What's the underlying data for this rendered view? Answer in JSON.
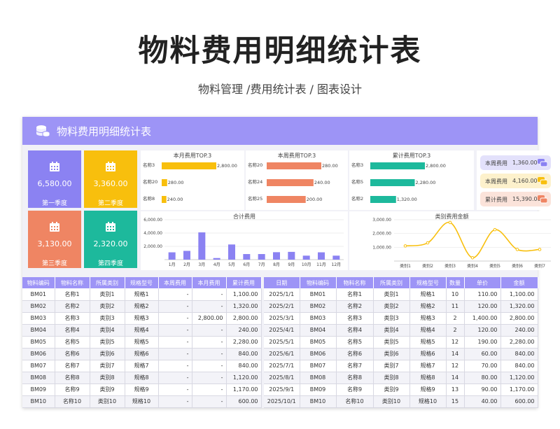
{
  "page": {
    "title": "物料费用明细统计表",
    "subtitle": "物料管理 /费用统计表 / 图表设计"
  },
  "sheet": {
    "header_title": "物料费用明细统计表",
    "header_icon": "coins-icon",
    "color_accent": "#9d94f6"
  },
  "kpi_tiles": [
    {
      "value": "6,580.00",
      "label": "第一季度",
      "color": "#8b82f2",
      "icon": "calendar-icon"
    },
    {
      "value": "3,360.00",
      "label": "第二季度",
      "color": "#f8bf0d",
      "icon": "calendar-icon"
    },
    {
      "value": "3,130.00",
      "label": "第三季度",
      "color": "#ef8563",
      "icon": "calendar-icon"
    },
    {
      "value": "2,320.00",
      "label": "第四季度",
      "color": "#1db99c",
      "icon": "calendar-icon"
    }
  ],
  "summary": [
    {
      "label": "本周费用",
      "value": "1,360.00",
      "bg": "#e3e1fb",
      "icon_color": "#8b82f2",
      "icon": "coins-icon"
    },
    {
      "label": "本周费用",
      "value": "4,160.00",
      "bg": "#fdf1cc",
      "icon_color": "#f8bf0d",
      "icon": "coins-icon"
    },
    {
      "label": "累计费用",
      "value": "15,390.00",
      "bg": "#fbe3da",
      "icon_color": "#ef8563",
      "icon": "coins-icon"
    }
  ],
  "chart_data": [
    {
      "type": "bar",
      "orientation": "horizontal",
      "title": "本月费用TOP.3",
      "color": "#f8bf0d",
      "categories": [
        "名称3",
        "名称20",
        "名称8"
      ],
      "values": [
        2800,
        280,
        240
      ],
      "value_labels": [
        "2,800.00",
        "280.00",
        "240.00"
      ],
      "xlim": [
        0,
        2800
      ]
    },
    {
      "type": "bar",
      "orientation": "horizontal",
      "title": "本周费用TOP.3",
      "color": "#ef8563",
      "categories": [
        "名称20",
        "名称24",
        "名称25"
      ],
      "values": [
        280,
        240,
        200
      ],
      "value_labels": [
        "280.00",
        "240.00",
        "200.00"
      ],
      "xlim": [
        0,
        280
      ]
    },
    {
      "type": "bar",
      "orientation": "horizontal",
      "title": "累计费用TOP.3",
      "color": "#1db99c",
      "categories": [
        "名称3",
        "名称5",
        "名称2"
      ],
      "values": [
        2800,
        2280,
        1320
      ],
      "value_labels": [
        "2,800.00",
        "2,280.00",
        "1,320.00"
      ],
      "xlim": [
        0,
        2800
      ]
    },
    {
      "type": "bar",
      "title": "合计费用",
      "color": "#8b82f2",
      "categories": [
        "1月",
        "2月",
        "3月",
        "4月",
        "5月",
        "6月",
        "7月",
        "8月",
        "9月",
        "10月",
        "11月",
        "12月"
      ],
      "values": [
        1100,
        1320,
        4100,
        240,
        2280,
        840,
        840,
        1120,
        1170,
        600,
        1100,
        600
      ],
      "yticks": [
        {
          "value": 0,
          "label": ""
        },
        {
          "value": 2000,
          "label": "2,000.00"
        },
        {
          "value": 4000,
          "label": "4,000.00"
        },
        {
          "value": 6000,
          "label": "6,000.00"
        }
      ],
      "ylim": [
        0,
        6000
      ],
      "grid": true
    },
    {
      "type": "line",
      "smooth": true,
      "title": "类别费用金额",
      "color": "#f8bf0d",
      "categories": [
        "类别1",
        "类别2",
        "类别3",
        "类别4",
        "类别5",
        "类别6",
        "类别7"
      ],
      "values": [
        1100,
        1320,
        2800,
        240,
        2280,
        840,
        840
      ],
      "yticks": [
        {
          "value": 0,
          "label": ""
        },
        {
          "value": 1000,
          "label": "1,000.00"
        },
        {
          "value": 2000,
          "label": "2,000.00"
        },
        {
          "value": 3000,
          "label": "3,000.00"
        }
      ],
      "ylim": [
        0,
        3000
      ],
      "grid": true
    }
  ],
  "left_table": {
    "headers": [
      "物料编码",
      "物料名称",
      "所属类别",
      "规格型号",
      "本周费用",
      "本月费用",
      "累计费用"
    ],
    "rows": [
      [
        "BM01",
        "名称1",
        "类别1",
        "规格1",
        "-",
        "-",
        "1,100.00"
      ],
      [
        "BM02",
        "名称2",
        "类别2",
        "规格2",
        "-",
        "-",
        "1,320.00"
      ],
      [
        "BM03",
        "名称3",
        "类别3",
        "规格3",
        "-",
        "2,800.00",
        "2,800.00"
      ],
      [
        "BM04",
        "名称4",
        "类别4",
        "规格4",
        "-",
        "-",
        "240.00"
      ],
      [
        "BM05",
        "名称5",
        "类别5",
        "规格5",
        "-",
        "-",
        "2,280.00"
      ],
      [
        "BM06",
        "名称6",
        "类别6",
        "规格6",
        "-",
        "-",
        "840.00"
      ],
      [
        "BM07",
        "名称7",
        "类别7",
        "规格7",
        "-",
        "-",
        "840.00"
      ],
      [
        "BM08",
        "名称8",
        "类别8",
        "规格8",
        "-",
        "-",
        "1,120.00"
      ],
      [
        "BM09",
        "名称9",
        "类别9",
        "规格9",
        "-",
        "-",
        "1,170.00"
      ],
      [
        "BM10",
        "名称10",
        "类别10",
        "规格10",
        "-",
        "-",
        "600.00"
      ]
    ]
  },
  "right_table": {
    "headers": [
      "日期",
      "物料编码",
      "物料名称",
      "所属类别",
      "规格型号",
      "数量",
      "单价",
      "金额"
    ],
    "rows": [
      [
        "2025/1/1",
        "BM01",
        "名称1",
        "类别1",
        "规格1",
        "10",
        "110.00",
        "1,100.00"
      ],
      [
        "2025/2/1",
        "BM02",
        "名称2",
        "类别2",
        "规格2",
        "11",
        "120.00",
        "1,320.00"
      ],
      [
        "2025/3/1",
        "BM03",
        "名称3",
        "类别3",
        "规格3",
        "2",
        "1,400.00",
        "2,800.00"
      ],
      [
        "2025/4/1",
        "BM04",
        "名称4",
        "类别4",
        "规格4",
        "2",
        "120.00",
        "240.00"
      ],
      [
        "2025/5/1",
        "BM05",
        "名称5",
        "类别5",
        "规格5",
        "12",
        "190.00",
        "2,280.00"
      ],
      [
        "2025/6/1",
        "BM06",
        "名称6",
        "类别6",
        "规格6",
        "14",
        "60.00",
        "840.00"
      ],
      [
        "2025/7/1",
        "BM07",
        "名称7",
        "类别7",
        "规格7",
        "12",
        "70.00",
        "840.00"
      ],
      [
        "2025/8/1",
        "BM08",
        "名称8",
        "类别8",
        "规格8",
        "14",
        "80.00",
        "1,120.00"
      ],
      [
        "2025/9/1",
        "BM09",
        "名称9",
        "类别9",
        "规格9",
        "13",
        "90.00",
        "1,170.00"
      ],
      [
        "2025/10/1",
        "BM10",
        "名称10",
        "类别10",
        "规格10",
        "15",
        "40.00",
        "600.00"
      ]
    ]
  }
}
